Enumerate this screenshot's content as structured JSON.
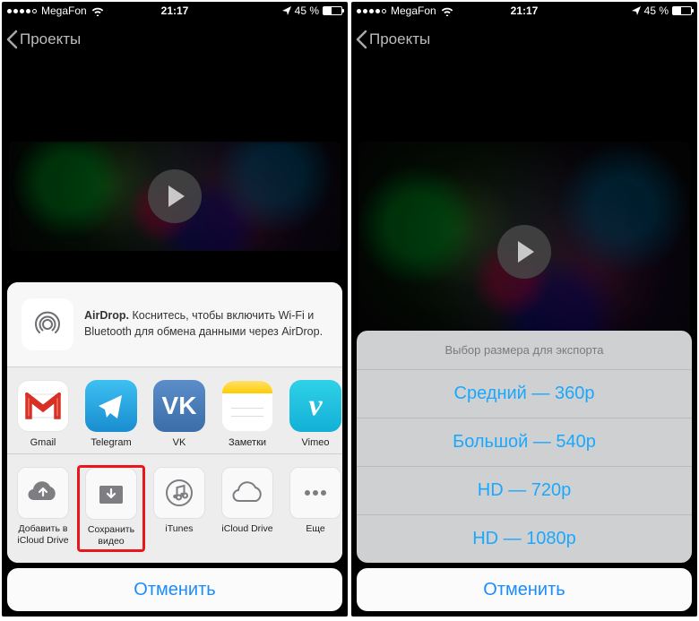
{
  "status": {
    "carrier": "MegaFon",
    "time": "21:17",
    "battery_pct": "45 %"
  },
  "nav": {
    "back_label": "Проекты"
  },
  "airdrop": {
    "title": "AirDrop.",
    "body": "Коснитесь, чтобы включить Wi-Fi и Bluetooth для обмена данными через AirDrop."
  },
  "apps": [
    {
      "label": "Gmail"
    },
    {
      "label": "Telegram"
    },
    {
      "label": "VK"
    },
    {
      "label": "Заметки"
    },
    {
      "label": "Vimeo"
    }
  ],
  "actions": [
    {
      "label": "Добавить в iCloud Drive"
    },
    {
      "label": "Сохранить видео"
    },
    {
      "label": "iTunes"
    },
    {
      "label": "iCloud Drive"
    },
    {
      "label": "Еще"
    }
  ],
  "cancel": "Отменить",
  "export": {
    "header": "Выбор размера для экспорта",
    "options": [
      "Средний — 360p",
      "Большой — 540p",
      "HD — 720p",
      "HD — 1080p"
    ]
  }
}
